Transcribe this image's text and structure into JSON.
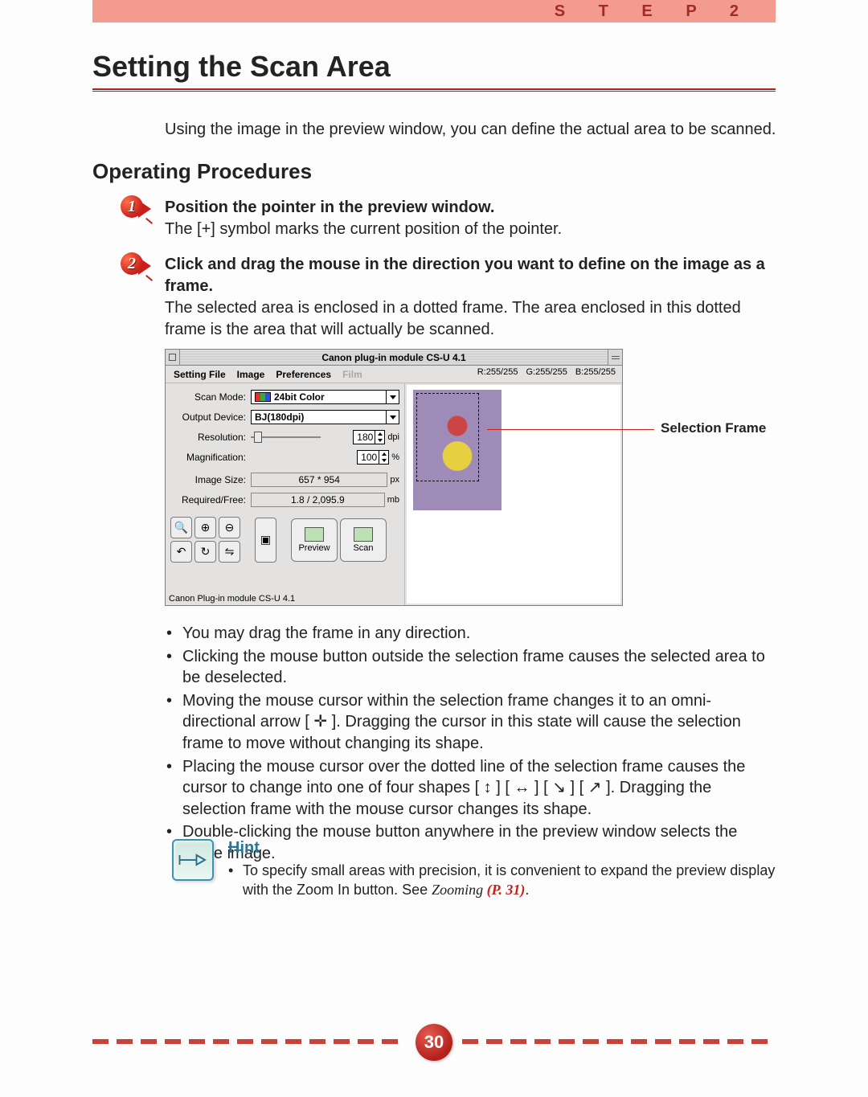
{
  "header": {
    "step_label": "S T E P   2"
  },
  "title": "Setting the Scan Area",
  "intro": "Using the image in the preview window, you can define the actual area to be scanned.",
  "section_heading": "Operating Procedures",
  "steps": [
    {
      "num": "1",
      "bold": "Position the pointer in the preview window.",
      "body": "The [+] symbol marks the current position of the pointer."
    },
    {
      "num": "2",
      "bold": "Click and drag the mouse in the direction you want to define on the image as a frame.",
      "body": "The selected area is enclosed in a dotted frame.  The area enclosed in this dotted frame is the area that will actually be scanned."
    }
  ],
  "app": {
    "title": "Canon plug-in module CS-U 4.1",
    "menu": [
      "Setting File",
      "Image",
      "Preferences"
    ],
    "menu_disabled": "Film",
    "rgb_r": "R:255/255",
    "rgb_g": "G:255/255",
    "rgb_b": "B:255/255",
    "labels": {
      "scan_mode": "Scan Mode:",
      "output_device": "Output Device:",
      "resolution": "Resolution:",
      "magnification": "Magnification:",
      "image_size": "Image Size:",
      "required_free": "Required/Free:"
    },
    "values": {
      "scan_mode": "24bit Color",
      "output_device": "BJ(180dpi)",
      "resolution": "180",
      "resolution_unit": "dpi",
      "magnification": "100",
      "magnification_unit": "%",
      "image_size": "657 * 954",
      "image_size_unit": "px",
      "required_free": "1.8 / 2,095.9",
      "required_free_unit": "mb"
    },
    "buttons": {
      "preview": "Preview",
      "scan": "Scan"
    },
    "status": "Canon Plug-in module CS-U 4.1"
  },
  "callout": "Selection Frame",
  "bullets": [
    "You may drag the frame in any direction.",
    "Clicking the mouse button outside the selection frame causes the selected area to be deselected.",
    "Moving the mouse cursor within the selection frame changes it to an omni-directional arrow [ ✛ ]. Dragging the cursor in this state will cause the selection frame to move without changing its shape.",
    "Placing the mouse cursor over the dotted line of the selection frame causes the cursor to change into one of four shapes [ ↕ ] [ ↔ ] [ ↘ ] [ ↗ ]. Dragging the selection frame with the mouse cursor changes its shape.",
    "Double-clicking the mouse button anywhere in the preview window selects the entire image."
  ],
  "hint": {
    "title": "Hint",
    "text_pre": "To specify small areas with precision, it is convenient to expand the preview display with the Zoom In button. See ",
    "text_em": "Zooming",
    "ref": " (P. 31)",
    "text_post": "."
  },
  "page_number": "30"
}
